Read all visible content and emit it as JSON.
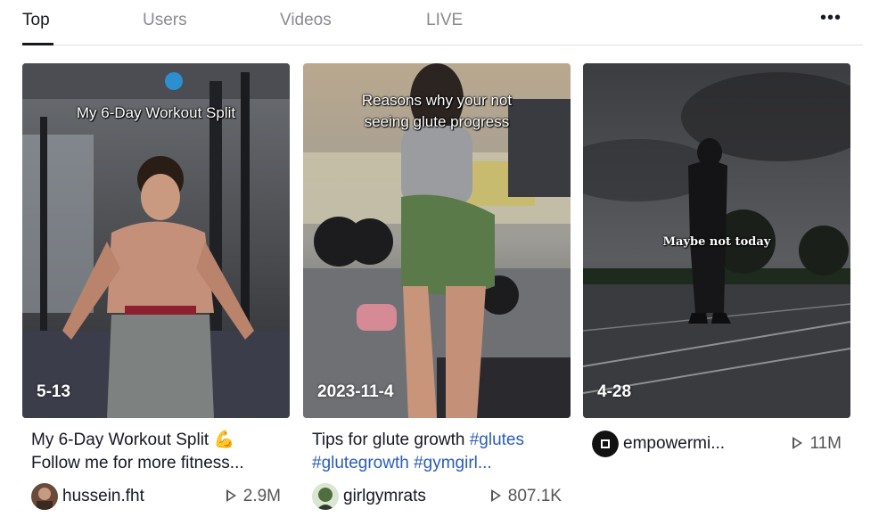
{
  "tabs": [
    {
      "label": "Top",
      "active": true
    },
    {
      "label": "Users"
    },
    {
      "label": "Videos"
    },
    {
      "label": "LIVE"
    }
  ],
  "more_label": "•••",
  "videos": [
    {
      "overlay_text": "My 6-Day Workout Split",
      "date": "5-13",
      "desc_line1": "My 6-Day Workout Split 💪",
      "desc_line2": "Follow me for more fitness...",
      "author": "hussein.fht",
      "views": "2.9M"
    },
    {
      "overlay_text_1": "Reasons why your not",
      "overlay_text_2": "seeing glute progress",
      "date": "2023-11-4",
      "desc_line1_text": "Tips for glute growth ",
      "desc_line1_tag": "#glutes",
      "desc_line2": "#glutegrowth #gymgirl...",
      "author": "girlgymrats",
      "views": "807.1K"
    },
    {
      "overlay_text": "Maybe not today",
      "date": "4-28",
      "author": "empowermi...",
      "views": "11M"
    }
  ],
  "colors": {
    "text": "#161823",
    "muted": "#8a8b91",
    "hashtag": "#2b5db9"
  }
}
